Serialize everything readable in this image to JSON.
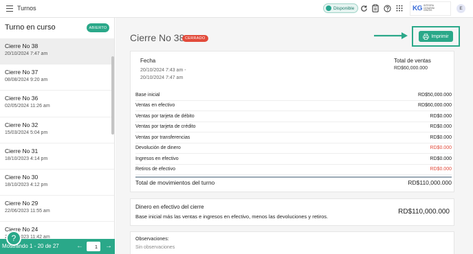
{
  "topbar": {
    "title": "Turnos",
    "status": "Disponible",
    "avatar_initial": "E",
    "logo_mark": "KG",
    "logo_lines": [
      "INTEGRA",
      "CESARINI",
      "GRATIS"
    ],
    "icons": [
      "menu-icon",
      "refresh-icon",
      "clipboard-icon",
      "help-circle-icon",
      "apps-grid-icon"
    ]
  },
  "sidebar": {
    "title": "Turno en curso",
    "open_badge": "ABIERTO",
    "items": [
      {
        "name": "Cierre No 38",
        "date": "20/10/2024 7:47 am"
      },
      {
        "name": "Cierre No 37",
        "date": "08/08/2024 9:20 am"
      },
      {
        "name": "Cierre No 36",
        "date": "02/05/2024 11:26 am"
      },
      {
        "name": "Cierre No 32",
        "date": "15/03/2024 5:04 pm"
      },
      {
        "name": "Cierre No 31",
        "date": "18/10/2023 4:14 pm"
      },
      {
        "name": "Cierre No 30",
        "date": "18/10/2023 4:12 pm"
      },
      {
        "name": "Cierre No 29",
        "date": "22/06/2023 11:55 am"
      },
      {
        "name": "Cierre No 24",
        "date": "20/06/2023 11:42 am"
      }
    ],
    "pager_text": "Mostrando 1 - 20 de 27",
    "page_value": "1"
  },
  "main": {
    "title": "Cierre No 38",
    "closed_badge": "CERRADO",
    "print_label": "Imprimir",
    "fecha_label": "Fecha",
    "fecha_value": "20/10/2024 7:43 am - 20/10/2024 7:47 am",
    "total_sales_label": "Total de ventas",
    "total_sales_value": "RD$60,000.000",
    "rows": [
      {
        "label": "Base inicial",
        "amount": "RD$50,000.000",
        "red": false
      },
      {
        "label": "Ventas en efectivo",
        "amount": "RD$60,000.000",
        "red": false
      },
      {
        "label": "Ventas por tarjeta de débito",
        "amount": "RD$0.000",
        "red": false
      },
      {
        "label": "Ventas por tarjeta de crédito",
        "amount": "RD$0.000",
        "red": false
      },
      {
        "label": "Ventas por transferencias",
        "amount": "RD$0.000",
        "red": false
      },
      {
        "label": "Devolución de dinero",
        "amount": "RD$0.000",
        "red": true
      },
      {
        "label": "Ingresos en efectivo",
        "amount": "RD$0.000",
        "red": false
      },
      {
        "label": "Retiros de efectivo",
        "amount": "RD$0.000",
        "red": true
      }
    ],
    "total_movements_label": "Total de movimientos del turno",
    "total_movements_value": "RD$110,000.000",
    "cash_title": "Dinero en efectivo del cierre",
    "cash_desc": "Base inicial más las ventas e ingresos en efectivo, menos las devoluciones y retiros.",
    "cash_amount": "RD$110,000.000",
    "obs_label": "Observaciones:",
    "obs_value": "Sin observaciones"
  },
  "colors": {
    "accent": "#2aa889",
    "danger": "#e24b3b"
  }
}
